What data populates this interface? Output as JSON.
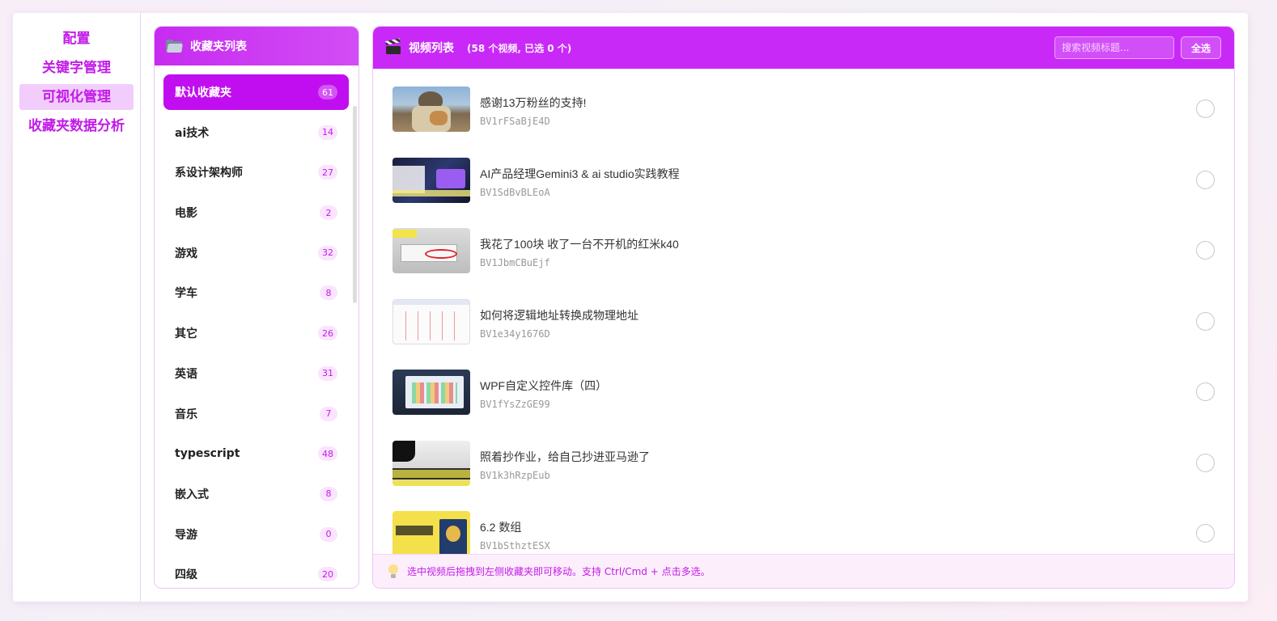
{
  "nav": {
    "items": [
      {
        "label": "配置"
      },
      {
        "label": "关键字管理"
      },
      {
        "label": "可视化管理",
        "active": true
      },
      {
        "label": "收藏夹数据分析"
      }
    ]
  },
  "folders": {
    "header_icon": "folder-icon",
    "title": "收藏夹列表",
    "items": [
      {
        "name": "默认收藏夹",
        "count": "61",
        "active": true
      },
      {
        "name": "ai技术",
        "count": "14"
      },
      {
        "name": "系设计架构师",
        "count": "27"
      },
      {
        "name": "电影",
        "count": "2"
      },
      {
        "name": "游戏",
        "count": "32"
      },
      {
        "name": "学车",
        "count": "8"
      },
      {
        "name": "其它",
        "count": "26"
      },
      {
        "name": "英语",
        "count": "31"
      },
      {
        "name": "音乐",
        "count": "7"
      },
      {
        "name": "typescript",
        "count": "48"
      },
      {
        "name": "嵌入式",
        "count": "8"
      },
      {
        "name": "导游",
        "count": "0"
      },
      {
        "name": "四级",
        "count": "20"
      }
    ]
  },
  "videos": {
    "header_icon": "clapperboard-icon",
    "title": "视频列表",
    "summary": "(58 个视频, 已选 0 个)",
    "search_placeholder": "搜索视频标题...",
    "select_all_label": "全选",
    "items": [
      {
        "title": "感谢13万粉丝的支持!",
        "bvid": "BV1rFSaBjE4D"
      },
      {
        "title": "AI产品经理Gemini3 & ai studio实践教程",
        "bvid": "BV1SdBvBLEoA"
      },
      {
        "title": "我花了100块 收了一台不开机的红米k40",
        "bvid": "BV1JbmCBuEjf"
      },
      {
        "title": "如何将逻辑地址转换成物理地址",
        "bvid": "BV1e34y1676D"
      },
      {
        "title": "WPF自定义控件库（四）",
        "bvid": "BV1fYsZzGE99"
      },
      {
        "title": "照着抄作业，给自己抄进亚马逊了",
        "bvid": "BV1k3hRzpEub"
      },
      {
        "title": "6.2 数组",
        "bvid": "BV1bSthztESX"
      }
    ],
    "footer_icon": "lightbulb-icon",
    "footer_tip": "选中视频后拖拽到左侧收藏夹即可移动。支持 Ctrl/Cmd + 点击多选。"
  },
  "colors": {
    "accent": "#c929f7",
    "active_folder": "#c10ef0",
    "nav_text": "#c21be8",
    "nav_active_bg": "#f2cdfb"
  }
}
